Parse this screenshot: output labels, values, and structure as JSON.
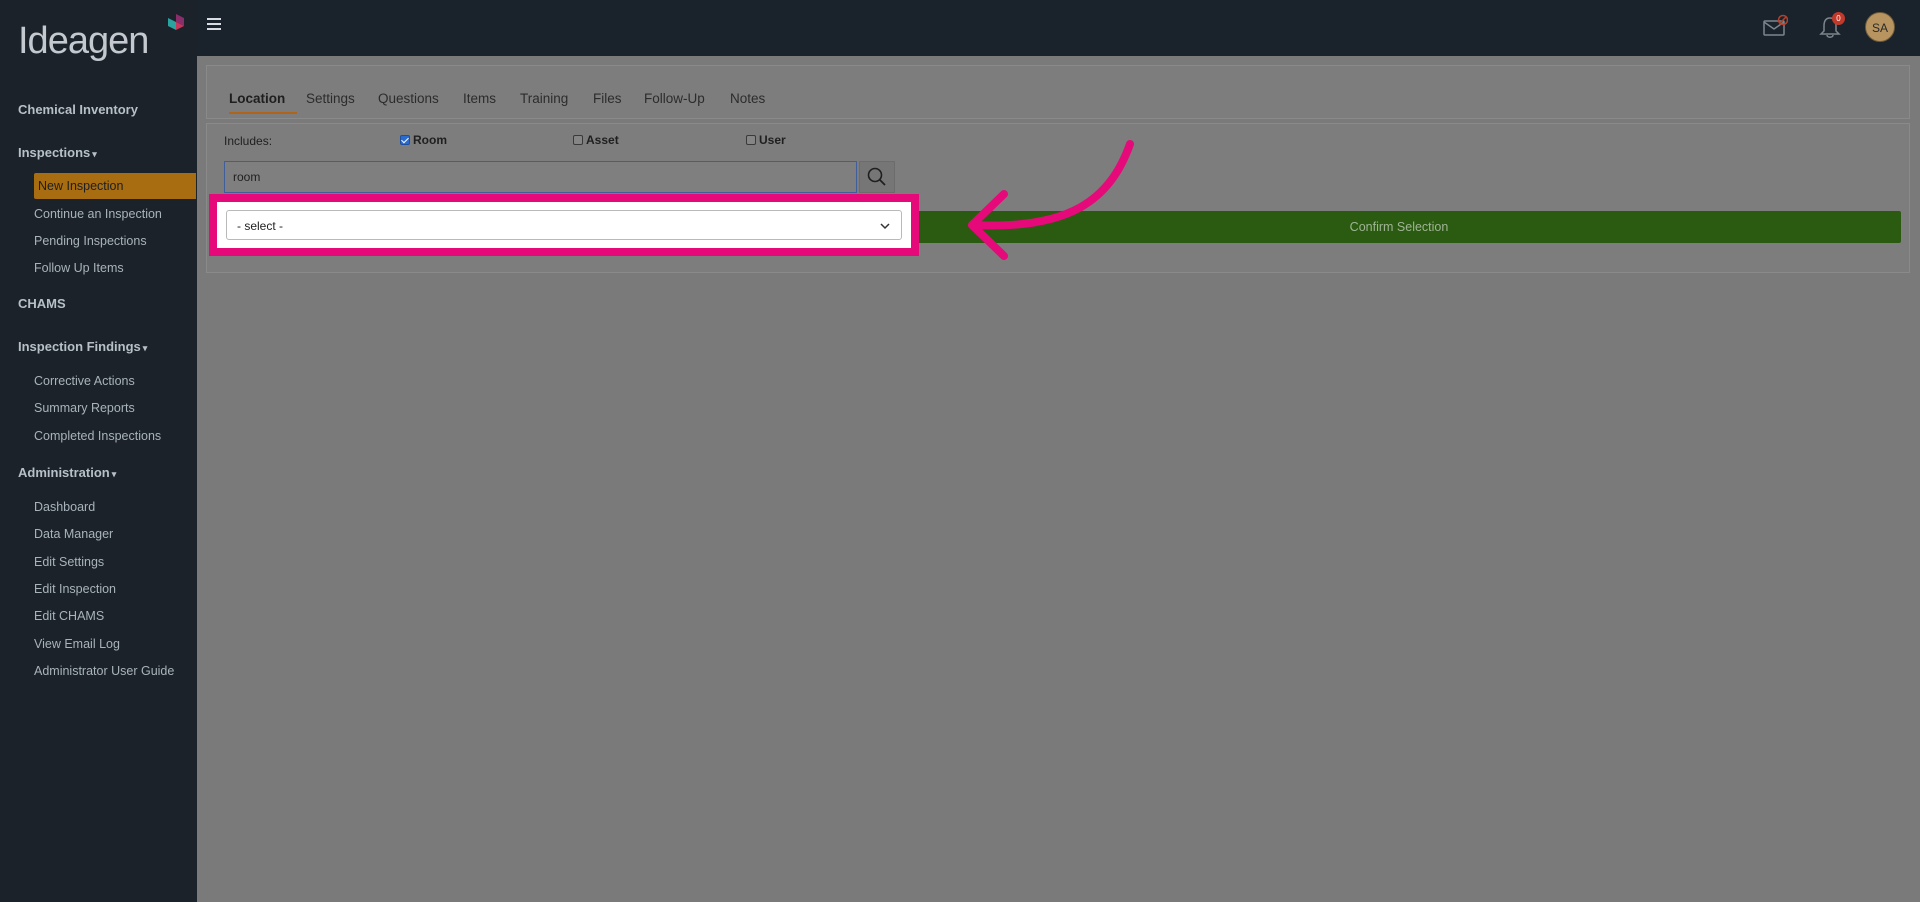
{
  "brand": {
    "logo_text": "Ideagen"
  },
  "sidebar": {
    "sections": [
      {
        "label": "Chemical Inventory",
        "has_caret": false
      },
      {
        "label": "Inspections",
        "has_caret": true,
        "items": [
          "New Inspection",
          "Continue an Inspection",
          "Pending Inspections",
          "Follow Up Items"
        ]
      },
      {
        "label": "CHAMS",
        "has_caret": false
      },
      {
        "label": "Inspection Findings",
        "has_caret": true,
        "items": [
          "Corrective Actions",
          "Summary Reports",
          "Completed Inspections"
        ]
      },
      {
        "label": "Administration",
        "has_caret": true,
        "items": [
          "Dashboard",
          "Data Manager",
          "Edit Settings",
          "Edit Inspection",
          "Edit CHAMS",
          "View Email Log",
          "Administrator User Guide"
        ]
      }
    ],
    "active_item": "New Inspection",
    "caret": "▾"
  },
  "topbar": {
    "notification_count": "0",
    "avatar_initials": "SA"
  },
  "tabs": [
    "Location",
    "Settings",
    "Questions",
    "Items",
    "Training",
    "Files",
    "Follow-Up",
    "Notes"
  ],
  "filter": {
    "includes_label": "Includes:",
    "options": [
      {
        "label": "Room",
        "checked": true
      },
      {
        "label": "Asset",
        "checked": false
      },
      {
        "label": "User",
        "checked": false
      }
    ],
    "search_value": "room",
    "select_value": "- select -",
    "confirm_label": "Confirm Selection"
  },
  "colors": {
    "highlight": "#e6097a",
    "confirm_button": "#2b5a11",
    "active_sidebar": "#a86d10"
  }
}
